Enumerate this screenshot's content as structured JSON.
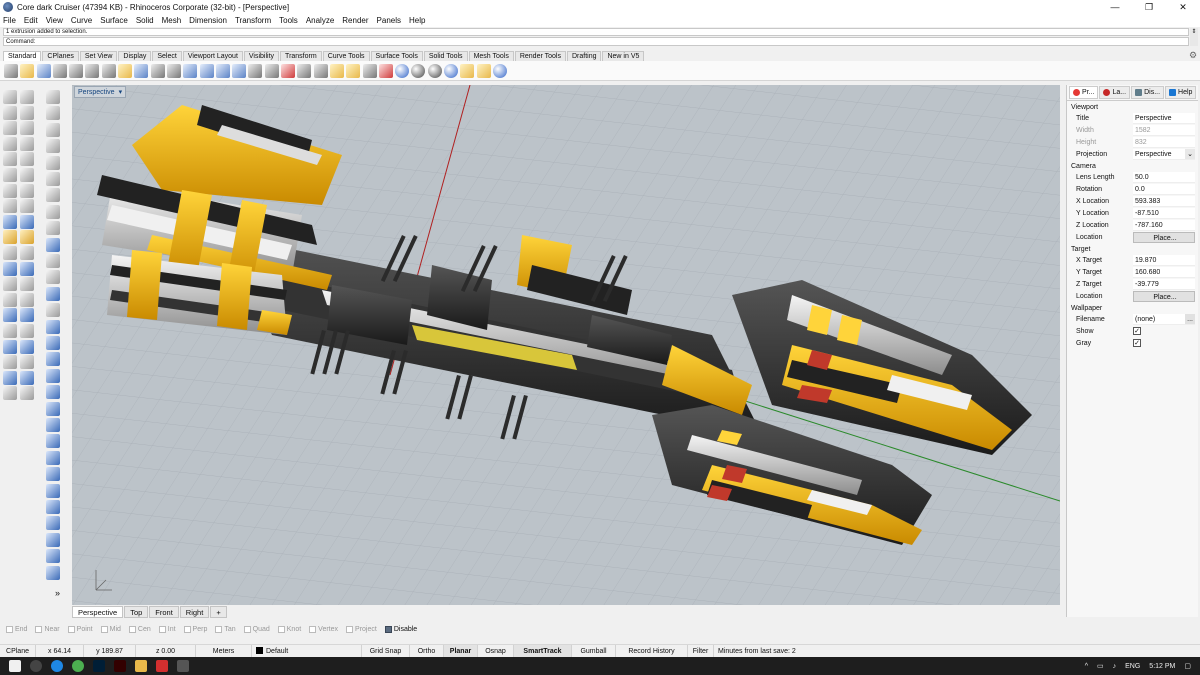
{
  "window": {
    "title": "Core dark Cruiser (47394 KB) - Rhinoceros Corporate (32-bit) - [Perspective]",
    "controls": [
      "—",
      "❐",
      "✕"
    ]
  },
  "menu": [
    "File",
    "Edit",
    "View",
    "Curve",
    "Surface",
    "Solid",
    "Mesh",
    "Dimension",
    "Transform",
    "Tools",
    "Analyze",
    "Render",
    "Panels",
    "Help"
  ],
  "command": {
    "history": "1 extrusion added to selection.",
    "prompt": "Command:"
  },
  "toolbar_tabs": [
    "Standard",
    "CPlanes",
    "Set View",
    "Display",
    "Select",
    "Viewport Layout",
    "Visibility",
    "Transform",
    "Curve Tools",
    "Surface Tools",
    "Solid Tools",
    "Mesh Tools",
    "Render Tools",
    "Drafting",
    "New in V5"
  ],
  "viewport": {
    "label": "Perspective",
    "tabs": [
      "Perspective",
      "Top",
      "Front",
      "Right",
      "+"
    ]
  },
  "osnap": [
    {
      "label": "End",
      "on": false
    },
    {
      "label": "Near",
      "on": false
    },
    {
      "label": "Point",
      "on": false
    },
    {
      "label": "Mid",
      "on": false
    },
    {
      "label": "Cen",
      "on": false
    },
    {
      "label": "Int",
      "on": false
    },
    {
      "label": "Perp",
      "on": false
    },
    {
      "label": "Tan",
      "on": false
    },
    {
      "label": "Quad",
      "on": false
    },
    {
      "label": "Knot",
      "on": false
    },
    {
      "label": "Vertex",
      "on": false
    },
    {
      "label": "Project",
      "on": false
    },
    {
      "label": "Disable",
      "on": true
    }
  ],
  "status": {
    "cplane": "CPlane",
    "x": "x 64.14",
    "y": "y 189.87",
    "z": "z 0.00",
    "units": "Meters",
    "layer": "Default",
    "grid_snap": "Grid Snap",
    "ortho": "Ortho",
    "planar": "Planar",
    "osnap": "Osnap",
    "smarttrack": "SmartTrack",
    "gumball": "Gumball",
    "record_history": "Record History",
    "filter": "Filter",
    "last_save": "Minutes from last save: 2"
  },
  "taskbar": {
    "lang": "ENG",
    "time": "5:12 PM"
  },
  "properties": {
    "tabs": [
      "Pr...",
      "La...",
      "Dis...",
      "Help"
    ],
    "viewport_header": "Viewport",
    "title_label": "Title",
    "title_value": "Perspective",
    "width_label": "Width",
    "width_value": "1582",
    "height_label": "Height",
    "height_value": "832",
    "projection_label": "Projection",
    "projection_value": "Perspective",
    "camera_header": "Camera",
    "lens_label": "Lens Length",
    "lens_value": "50.0",
    "rotation_label": "Rotation",
    "rotation_value": "0.0",
    "xloc_label": "X Location",
    "xloc_value": "593.383",
    "yloc_label": "Y Location",
    "yloc_value": "-87.510",
    "zloc_label": "Z Location",
    "zloc_value": "-787.160",
    "location_label": "Location",
    "place_button": "Place...",
    "target_header": "Target",
    "xtgt_label": "X Target",
    "xtgt_value": "19.870",
    "ytgt_label": "Y Target",
    "ytgt_value": "160.680",
    "ztgt_label": "Z Target",
    "ztgt_value": "-39.779",
    "tlocation_label": "Location",
    "tplace_button": "Place...",
    "wallpaper_header": "Wallpaper",
    "filename_label": "Filename",
    "filename_value": "(none)",
    "filename_browse": "...",
    "show_label": "Show",
    "show_check": "✓",
    "gray_label": "Gray",
    "gray_check": "✓"
  },
  "colors": {
    "hull_yellow": "#f2b200",
    "hull_dark": "#2a2a2a",
    "viewport_bg": "#bcc3c9",
    "axis_red": "#b02020",
    "axis_green": "#2b8a2b"
  }
}
